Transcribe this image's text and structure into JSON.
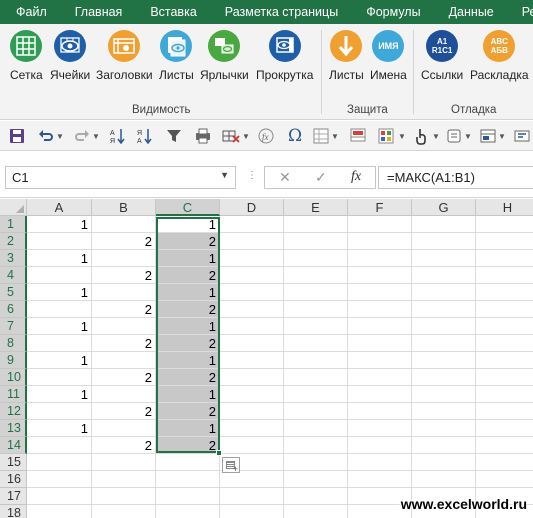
{
  "menu": {
    "tabs": [
      "Файл",
      "Главная",
      "Вставка",
      "Разметка страницы",
      "Формулы",
      "Данные",
      "Реце"
    ]
  },
  "ribbon": {
    "groups": [
      {
        "label": "Видимость"
      },
      {
        "label": "Защита"
      },
      {
        "label": "Отладка"
      }
    ],
    "buttons": [
      {
        "label": "Сетка",
        "icon": "grid-icon"
      },
      {
        "label": "Ячейки",
        "icon": "eye-cells-icon"
      },
      {
        "label": "Заголовки",
        "icon": "film-headers-icon"
      },
      {
        "label": "Листы",
        "icon": "sheets-icon"
      },
      {
        "label": "Ярлычки",
        "icon": "tabs-icon"
      },
      {
        "label": "Прокрутка",
        "icon": "scroll-eye-icon"
      },
      {
        "label": "Листы",
        "icon": "protect-sheets-icon"
      },
      {
        "label": "Имена",
        "icon": "names-icon",
        "icon_text": "ИМЯ"
      },
      {
        "label": "Ссылки",
        "icon": "r1c1-icon",
        "icon_text": "A1\nR1C1"
      },
      {
        "label": "Раскладка",
        "icon": "layout-icon",
        "icon_text": "ABC\nАБВ"
      }
    ]
  },
  "formula_bar": {
    "name_box": "C1",
    "formula": "=МАКС(A1:B1)",
    "fx_symbol": "fx"
  },
  "grid": {
    "columns": [
      "A",
      "B",
      "C",
      "D",
      "E",
      "F",
      "G",
      "H"
    ],
    "selected_column": "C",
    "rows": [
      {
        "n": "1",
        "a": "1",
        "b": "",
        "c": "1"
      },
      {
        "n": "2",
        "a": "",
        "b": "2",
        "c": "2"
      },
      {
        "n": "3",
        "a": "1",
        "b": "",
        "c": "1"
      },
      {
        "n": "4",
        "a": "",
        "b": "2",
        "c": "2"
      },
      {
        "n": "5",
        "a": "1",
        "b": "",
        "c": "1"
      },
      {
        "n": "6",
        "a": "",
        "b": "2",
        "c": "2"
      },
      {
        "n": "7",
        "a": "1",
        "b": "",
        "c": "1"
      },
      {
        "n": "8",
        "a": "",
        "b": "2",
        "c": "2"
      },
      {
        "n": "9",
        "a": "1",
        "b": "",
        "c": "1"
      },
      {
        "n": "10",
        "a": "",
        "b": "2",
        "c": "2"
      },
      {
        "n": "11",
        "a": "1",
        "b": "",
        "c": "1"
      },
      {
        "n": "12",
        "a": "",
        "b": "2",
        "c": "2"
      },
      {
        "n": "13",
        "a": "1",
        "b": "",
        "c": "1"
      },
      {
        "n": "14",
        "a": "",
        "b": "2",
        "c": "2"
      },
      {
        "n": "15",
        "a": "",
        "b": "",
        "c": ""
      },
      {
        "n": "16",
        "a": "",
        "b": "",
        "c": ""
      },
      {
        "n": "17",
        "a": "",
        "b": "",
        "c": ""
      },
      {
        "n": "18",
        "a": "",
        "b": "",
        "c": ""
      }
    ]
  },
  "watermark": "www.excelworld.ru",
  "colors": {
    "accent": "#217346",
    "selection": "#c8c8c8"
  }
}
